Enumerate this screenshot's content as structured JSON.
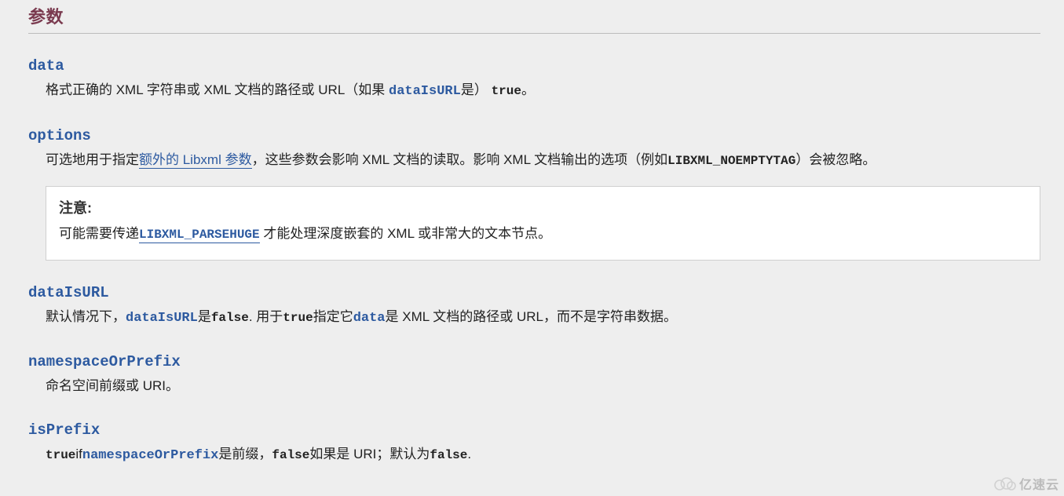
{
  "section": {
    "title": "参数"
  },
  "params": {
    "data": {
      "name": "data",
      "desc_pre": "格式正确的 XML 字符串或 XML 文档的路径或 URL（如果 ",
      "link": "dataIsURL",
      "desc_mid": "是）",
      "code": "true",
      "desc_post": "。"
    },
    "options": {
      "name": "options",
      "desc_pre": "可选地用于指定",
      "link": "额外的 Libxml 参数",
      "desc_mid": "，这些参数会影响 XML 文档的读取。影响 XML 文档输出的选项（例如",
      "code": "LIBXML_NOEMPTYTAG",
      "desc_post": "）会被忽略。",
      "note": {
        "title": "注意:",
        "pre": "可能需要传递",
        "link": "LIBXML_PARSEHUGE",
        "post": " 才能处理深度嵌套的 XML 或非常大的文本节点。"
      }
    },
    "dataIsURL": {
      "name": "dataIsURL",
      "d1": "默认情况下，",
      "p1": "dataIsURL",
      "d2": "是",
      "c1": "false",
      "d3": ". 用于",
      "c2": "true",
      "d4": "指定它",
      "p2": "data",
      "d5": "是 XML 文档的路径或 URL，而不是字符串数据。"
    },
    "namespaceOrPrefix": {
      "name": "namespaceOrPrefix",
      "desc": "命名空间前缀或 URI。"
    },
    "isPrefix": {
      "name": "isPrefix",
      "c1": "true",
      "d1": "if",
      "p1": "namespaceOrPrefix",
      "d2": "是前缀，",
      "c2": "false",
      "d3": "如果是 URI；默认为",
      "c3": "false",
      "d4": "."
    }
  },
  "watermark": {
    "text": "亿速云"
  }
}
